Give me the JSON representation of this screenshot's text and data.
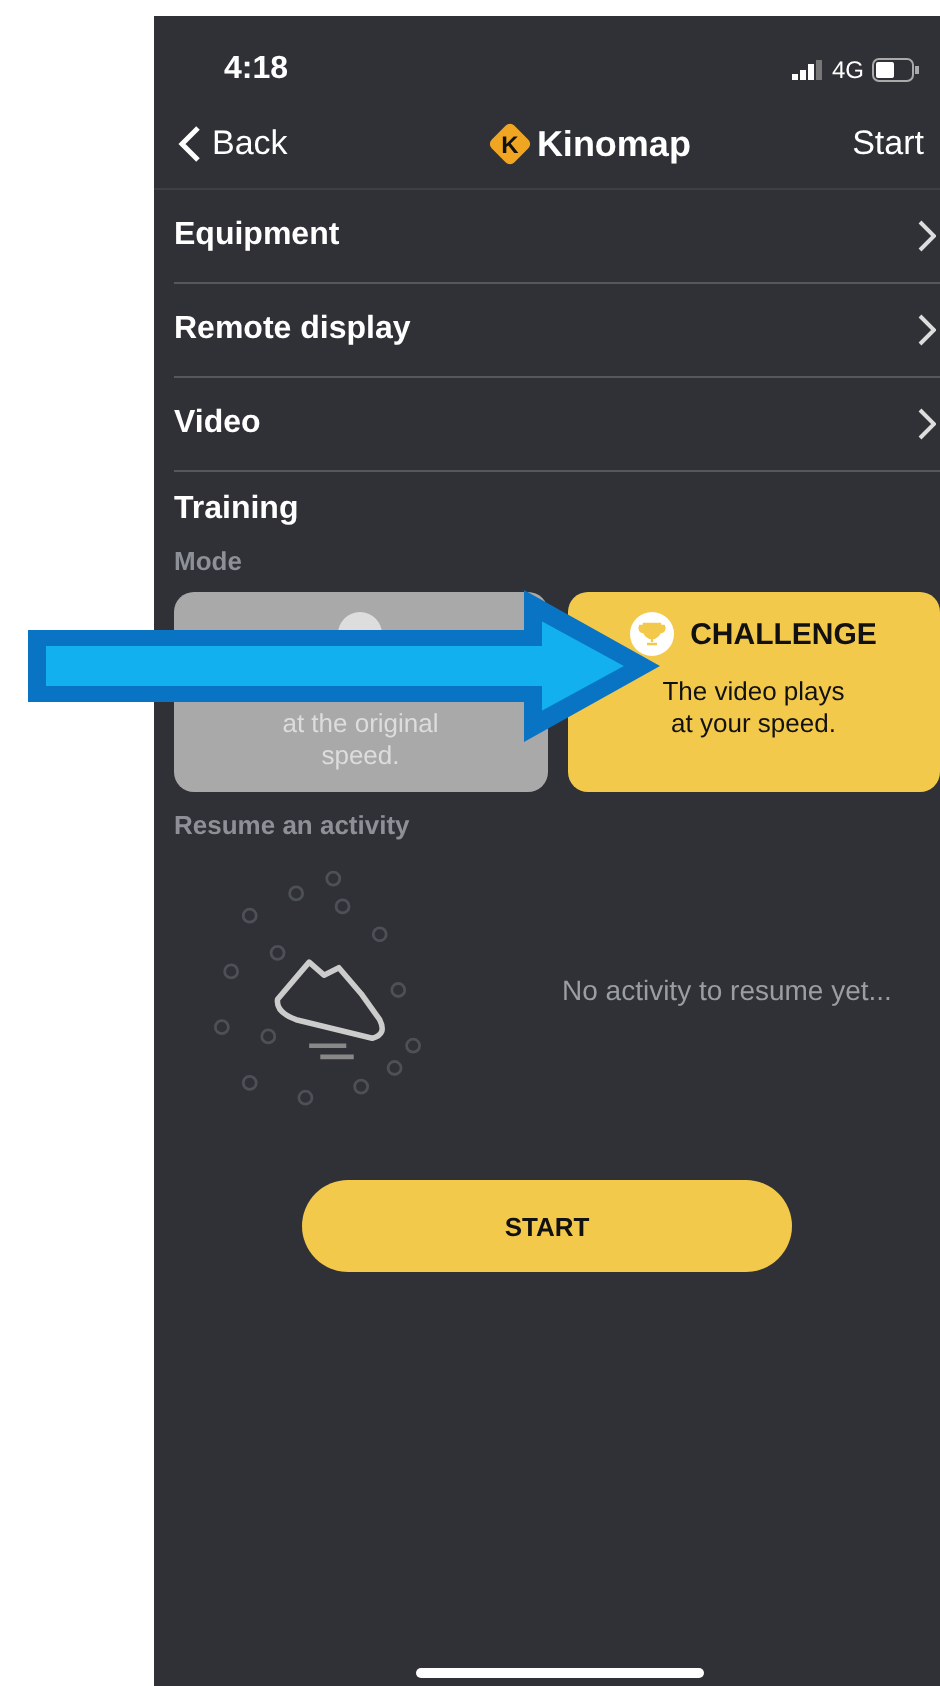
{
  "status_bar": {
    "time": "4:18",
    "network": "4G"
  },
  "nav": {
    "back": "Back",
    "logo_letter": "K",
    "brand": "Kinomap",
    "action": "Start"
  },
  "menu": [
    {
      "label": "Equipment"
    },
    {
      "label": "Remote display"
    },
    {
      "label": "Video"
    }
  ],
  "training": {
    "title": "Training",
    "mode_label": "Mode",
    "modes": [
      {
        "kind": "discovery",
        "description": "at the original speed.",
        "selected": false
      },
      {
        "kind": "challenge",
        "title": "CHALLENGE",
        "description": "The video plays at your speed.",
        "selected": true
      }
    ]
  },
  "resume": {
    "title": "Resume an activity",
    "empty_message": "No activity to resume yet..."
  },
  "start_button": "START"
}
